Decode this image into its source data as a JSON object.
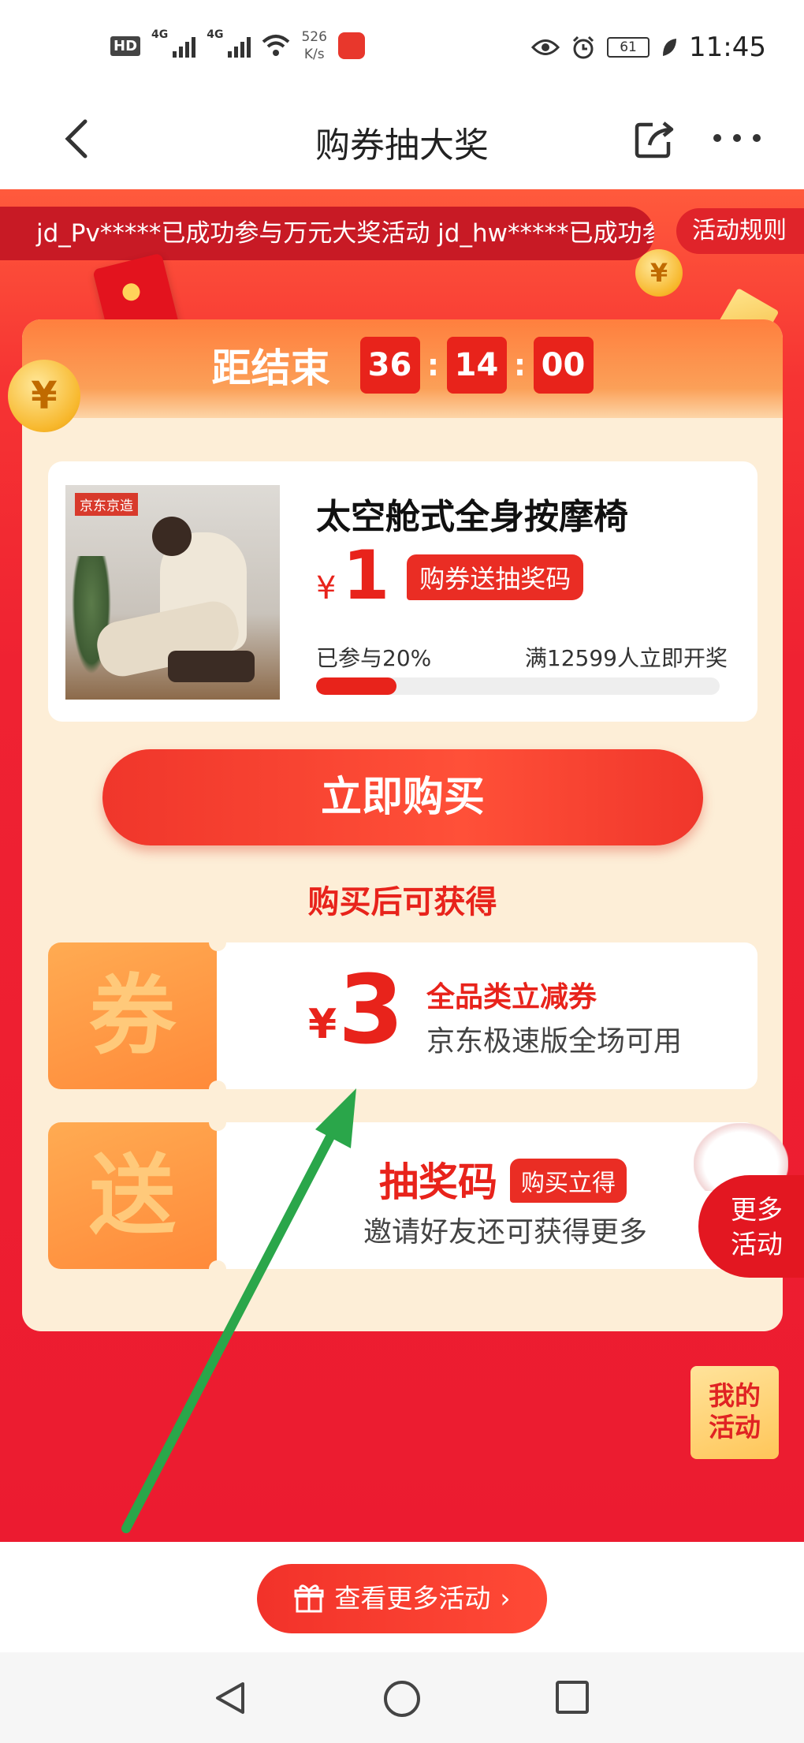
{
  "status_bar": {
    "hd_label": "HD",
    "net_labels": [
      "4G",
      "4G"
    ],
    "speed_value": "526",
    "speed_unit": "K/s",
    "battery": "61",
    "time": "11:45"
  },
  "nav": {
    "title": "购券抽大奖"
  },
  "ticker": {
    "text": "jd_Pv*****已成功参与万元大奖活动 jd_hw*****已成功参与"
  },
  "rules_label": "活动规则",
  "countdown": {
    "label": "距结束",
    "hours": "36",
    "minutes": "14",
    "seconds": "00"
  },
  "product": {
    "brand": "京东京造",
    "name": "太空舱式全身按摩椅",
    "price_symbol": "¥",
    "price": "1",
    "price_tag": "购券送抽奖码",
    "progress_label": "已参与20%",
    "progress_fraction": 0.2,
    "threshold_label": "满12599人立即开奖"
  },
  "buy_button": "立即购买",
  "after_purchase_label": "购买后可获得",
  "coupon": {
    "stub": "券",
    "symbol": "¥",
    "value": "3",
    "title": "全品类立减券",
    "desc": "京东极速版全场可用"
  },
  "lottery": {
    "stub": "送",
    "title": "抽奖码",
    "tag": "购买立得",
    "desc": "邀请好友还可获得更多"
  },
  "side": {
    "more_activities_line1": "更多",
    "more_activities_line2": "活动",
    "my_activities_line1": "我的",
    "my_activities_line2": "活动"
  },
  "bottom": {
    "see_more": "查看更多活动",
    "chevron": "›"
  },
  "colors": {
    "brand_red": "#e8231b",
    "annotation_arrow": "#2aa64a"
  }
}
